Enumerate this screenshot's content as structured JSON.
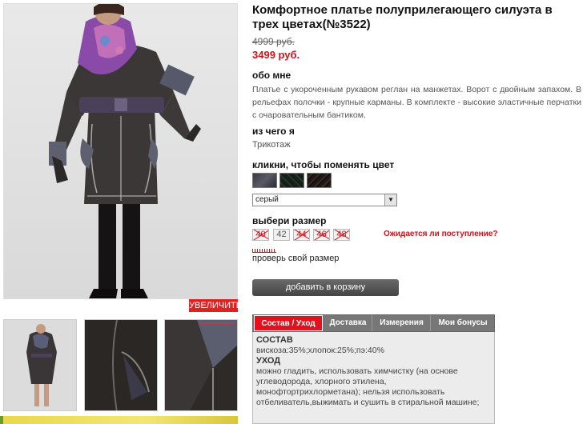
{
  "gallery": {
    "zoom_label": "УВЕЛИЧИТЬ"
  },
  "product": {
    "title": "Комфортное платье полуприлегающего силуэта в трех цветах(№3522)",
    "old_price": "4999 руб.",
    "new_price": "3499 руб.",
    "about_heading": "обо мне",
    "description": "Платье с укороченным рукавом реглан на манжетах. Ворот с двойным запахом. В рельефах полочки - крупные карманы. В комплекте - высокие эластичные перчатки с очаровательным бантиком.",
    "material_heading": "из чего я",
    "material": "Трикотаж",
    "color_heading": "кликни, чтобы поменять цвет",
    "color_select_value": "серый",
    "size_heading": "выбери размер",
    "sizes": [
      {
        "label": "40",
        "available": false
      },
      {
        "label": "42",
        "available": true
      },
      {
        "label": "44",
        "available": false
      },
      {
        "label": "46",
        "available": false
      },
      {
        "label": "48",
        "available": false
      }
    ],
    "wait_link": "Ожидается ли поступление?",
    "check_size": "проверь свой размер",
    "add_to_cart": "добавить в корзину"
  },
  "tabs": [
    {
      "label": "Состав / Уход",
      "active": true
    },
    {
      "label": "Доставка",
      "active": false
    },
    {
      "label": "Измерения",
      "active": false
    },
    {
      "label": "Мои бонусы",
      "active": false
    }
  ],
  "tab_content": {
    "composition_heading": "СОСТАВ",
    "composition": "вискоза:35%;хлопок:25%;пэ:40%",
    "care_heading": "УХОД",
    "care": "можно гладить, использовать химчистку (на основе углеводорода, хлорного этилена, монофтортрихлорметана); нельзя использовать отбеливатель,выжимать и сушить в стиральной машине;"
  },
  "colors": {
    "accent": "#d0121b",
    "tab_active": "#e4101b"
  }
}
